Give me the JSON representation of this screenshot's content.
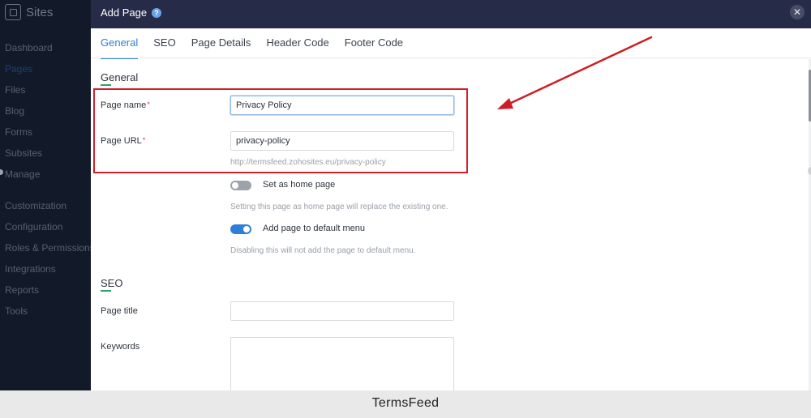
{
  "sidebar": {
    "brand": "Sites",
    "items": [
      {
        "label": "Dashboard"
      },
      {
        "label": "Pages"
      },
      {
        "label": "Files"
      },
      {
        "label": "Blog"
      },
      {
        "label": "Forms"
      },
      {
        "label": "Subsites"
      },
      {
        "label": "Manage"
      },
      {
        "label": "Customization"
      },
      {
        "label": "Configuration"
      },
      {
        "label": "Roles & Permissions"
      },
      {
        "label": "Integrations"
      },
      {
        "label": "Reports"
      },
      {
        "label": "Tools"
      }
    ]
  },
  "dialog": {
    "title": "Add Page",
    "help_icon": "?",
    "close_icon": "✕",
    "tabs": [
      {
        "label": "General"
      },
      {
        "label": "SEO"
      },
      {
        "label": "Page Details"
      },
      {
        "label": "Header Code"
      },
      {
        "label": "Footer Code"
      }
    ],
    "general": {
      "heading": "General",
      "page_name_label": "Page name",
      "page_name_value": "Privacy Policy",
      "page_url_label": "Page URL",
      "page_url_value": "privacy-policy",
      "required_mark": "*",
      "url_preview": "http://termsfeed.zohosites.eu/privacy-policy",
      "home_toggle_label": "Set as home page",
      "home_toggle_hint": "Setting this page as home page will replace the existing one.",
      "menu_toggle_label": "Add page to default menu",
      "menu_toggle_hint": "Disabling this will not add the page to default menu."
    },
    "seo": {
      "heading": "SEO",
      "page_title_label": "Page title",
      "page_title_value": "",
      "keywords_label": "Keywords",
      "keywords_value": ""
    }
  },
  "footer": {
    "brand": "TermsFeed"
  },
  "colors": {
    "accent": "#2f7fd6",
    "header_bg": "#262c48",
    "sidebar_bg": "#121a29",
    "highlight": "#d0202a"
  }
}
